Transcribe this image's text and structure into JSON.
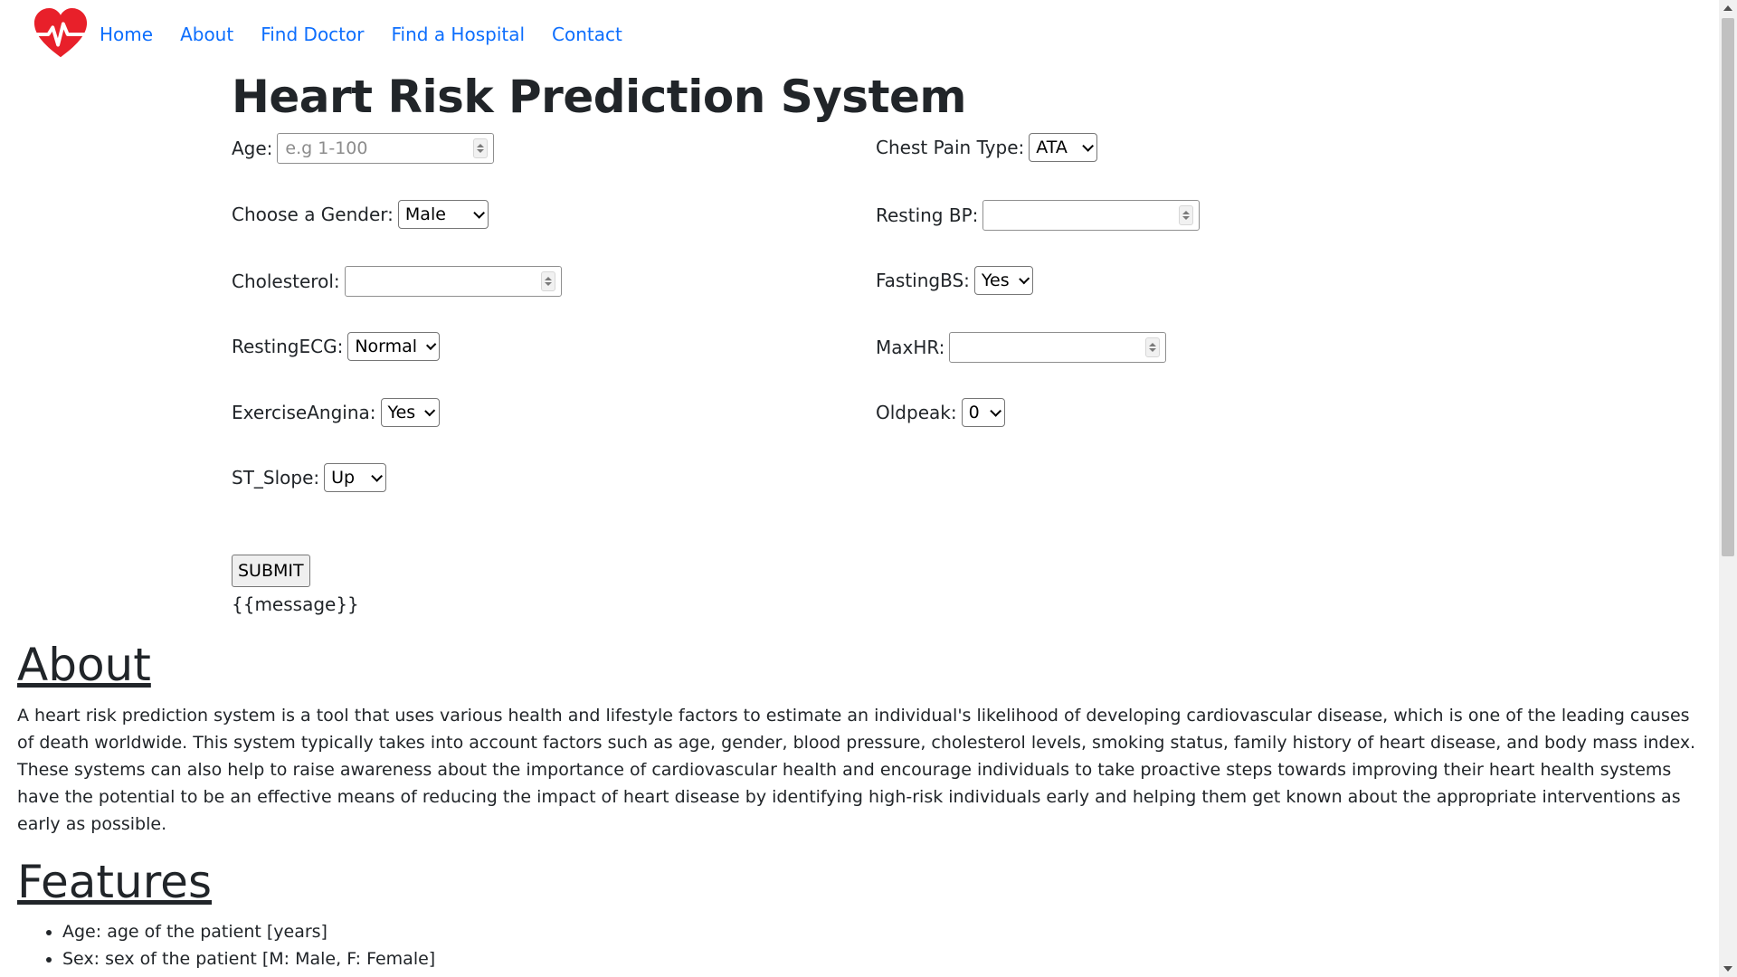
{
  "nav": {
    "links": [
      "Home",
      "About",
      "Find Doctor",
      "Find a Hospital",
      "Contact"
    ]
  },
  "colors": {
    "link": "#0d6efd",
    "heart": "#e8202a"
  },
  "title": "Heart Risk Prediction System",
  "form": {
    "age": {
      "label": "Age:",
      "placeholder": "e.g 1-100"
    },
    "gender": {
      "label": "Choose a Gender:",
      "value": "Male"
    },
    "cholesterol": {
      "label": "Cholesterol:"
    },
    "resting_ecg": {
      "label": "RestingECG:",
      "value": "Normal"
    },
    "exercise_angina": {
      "label": "ExerciseAngina:",
      "value": "Yes"
    },
    "st_slope": {
      "label": "ST_Slope:",
      "value": "Up"
    },
    "chest_pain": {
      "label": "Chest Pain Type:",
      "value": "ATA"
    },
    "resting_bp": {
      "label": "Resting BP:"
    },
    "fasting_bs": {
      "label": "FastingBS:",
      "value": "Yes"
    },
    "max_hr": {
      "label": "MaxHR:"
    },
    "oldpeak": {
      "label": "Oldpeak:",
      "value": "0"
    },
    "submit_label": "SUBMIT",
    "message": "{{message}}"
  },
  "about": {
    "heading": "About",
    "text": "A heart risk prediction system is a tool that uses various health and lifestyle factors to estimate an individual's likelihood of developing cardiovascular disease, which is one of the leading causes of death worldwide. This system typically takes into account factors such as age, gender, blood pressure, cholesterol levels, smoking status, family history of heart disease, and body mass index. These systems can also help to raise awareness about the importance of cardiovascular health and encourage individuals to take proactive steps towards improving their heart health systems have the potential to be an effective means of reducing the impact of heart disease by identifying high-risk individuals early and helping them get known about the appropriate interventions as early as possible."
  },
  "features": {
    "heading": "Features",
    "items": [
      "Age: age of the patient [years]",
      "Sex: sex of the patient [M: Male, F: Female]"
    ]
  },
  "icons": {
    "logo": "heart-pulse-icon"
  }
}
